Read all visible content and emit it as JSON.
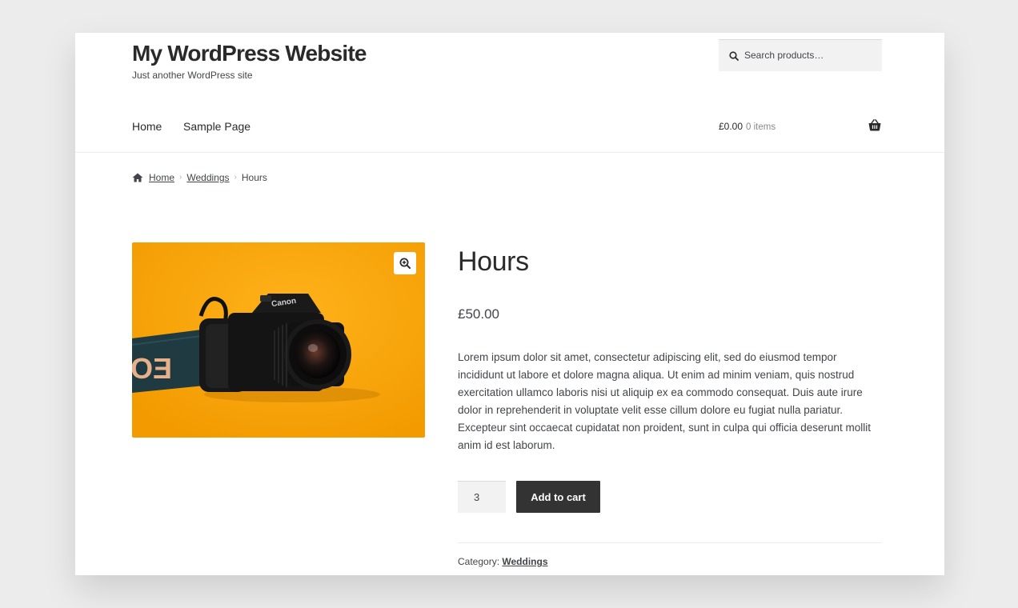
{
  "site": {
    "title": "My WordPress Website",
    "tagline": "Just another WordPress site"
  },
  "search": {
    "placeholder": "Search products…",
    "icon": "search-icon"
  },
  "nav": {
    "items": [
      {
        "label": "Home"
      },
      {
        "label": "Sample Page"
      }
    ]
  },
  "cart": {
    "total": "£0.00",
    "count": "0 items",
    "icon": "basket-icon"
  },
  "breadcrumb": {
    "home": "Home",
    "category": "Weddings",
    "current": "Hours"
  },
  "product": {
    "title": "Hours",
    "price": "£50.00",
    "description": "Lorem ipsum dolor sit amet, consectetur adipiscing elit, sed do eiusmod tempor incididunt ut labore et dolore magna aliqua. Ut enim ad minim veniam, quis nostrud exercitation ullamco laboris nisi ut aliquip ex ea commodo consequat. Duis aute irure dolor in reprehenderit in voluptate velit esse cillum dolore eu fugiat nulla pariatur. Excepteur sint occaecat cupidatat non proident, sunt in culpa qui officia deserunt mollit anim id est laborum.",
    "quantity": "3",
    "add_to_cart_label": "Add to cart",
    "category_label": "Category:",
    "category": "Weddings",
    "image_strap_text": "EO",
    "camera_brand_text": "Canon"
  },
  "colors": {
    "image_background": "#f6a406",
    "button": "#333333",
    "page_background": "#ececec"
  }
}
